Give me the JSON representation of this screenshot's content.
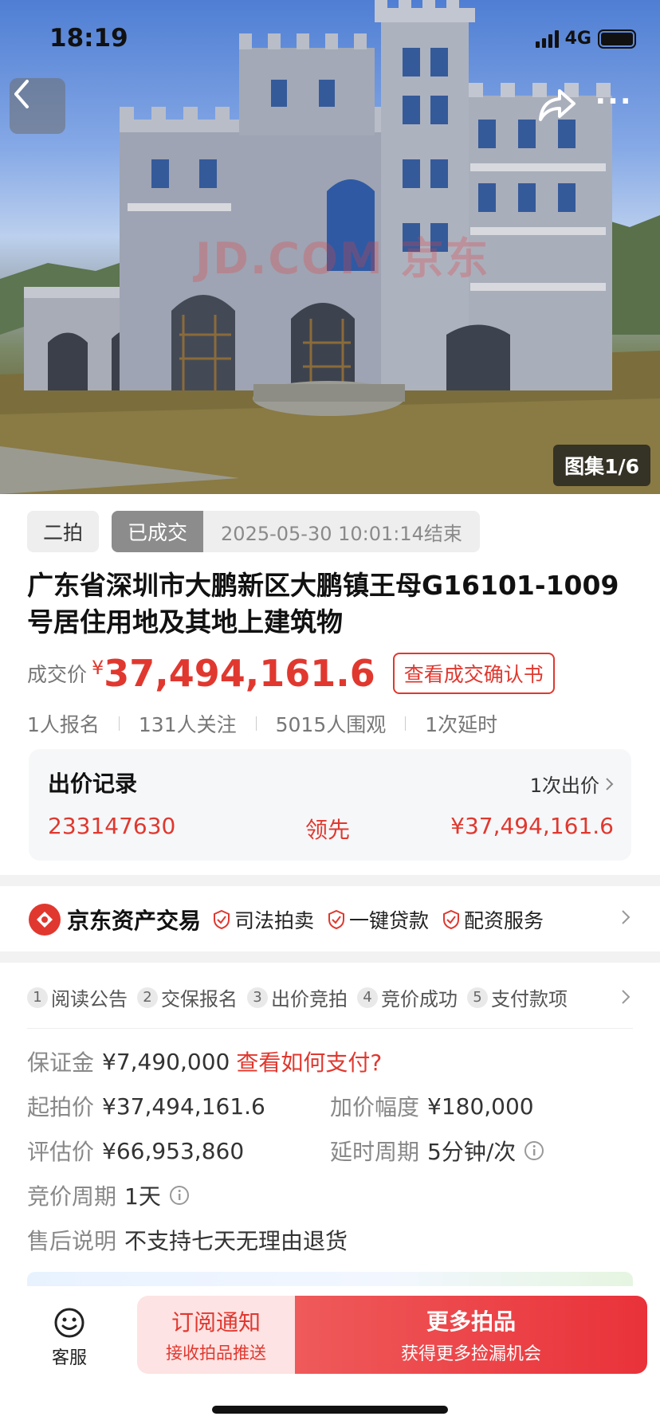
{
  "status_bar": {
    "time": "18:19",
    "network": "4G"
  },
  "hero": {
    "watermark": "JD.COM 京东",
    "gallery_counter": "图集1/6"
  },
  "auction": {
    "round": "二拍",
    "status": "已成交",
    "end_time": "2025-05-30 10:01:14结束",
    "title": "广东省深圳市大鹏新区大鹏镇王母G16101-1009号居住用地及其地上建筑物",
    "price_label": "成交价",
    "currency_symbol": "¥",
    "price": "37,494,161.6",
    "confirm_button": "查看成交确认书"
  },
  "stats": {
    "signups": "1人报名",
    "followers": "131人关注",
    "views": "5015人围观",
    "extensions": "1次延时"
  },
  "bid_record": {
    "title": "出价记录",
    "count": "1次出价",
    "user_id": "233147630",
    "status": "领先",
    "amount": "¥37,494,161.6"
  },
  "jd_bar": {
    "brand": "京东资产交易",
    "features": [
      "司法拍卖",
      "一键贷款",
      "配资服务"
    ]
  },
  "steps": [
    {
      "num": "1",
      "label": "阅读公告"
    },
    {
      "num": "2",
      "label": "交保报名"
    },
    {
      "num": "3",
      "label": "出价竞拍"
    },
    {
      "num": "4",
      "label": "竞价成功"
    },
    {
      "num": "5",
      "label": "支付款项"
    }
  ],
  "details": {
    "deposit_label": "保证金",
    "deposit_value": "¥7,490,000",
    "deposit_link": "查看如何支付?",
    "start_label": "起拍价",
    "start_value": "¥37,494,161.6",
    "increment_label": "加价幅度",
    "increment_value": "¥180,000",
    "appraisal_label": "评估价",
    "appraisal_value": "¥66,953,860",
    "delay_label": "延时周期",
    "delay_value": "5分钟/次",
    "cycle_label": "竞价周期",
    "cycle_value": "1天",
    "aftersale_label": "售后说明",
    "aftersale_value": "不支持七天无理由退货"
  },
  "bottom_bar": {
    "service_label": "客服",
    "subscribe_main": "订阅通知",
    "subscribe_sub": "接收拍品推送",
    "more_main": "更多拍品",
    "more_sub": "获得更多捡漏机会"
  },
  "colors": {
    "accent": "#e0382f",
    "status_tag": "#8c8c8c"
  }
}
